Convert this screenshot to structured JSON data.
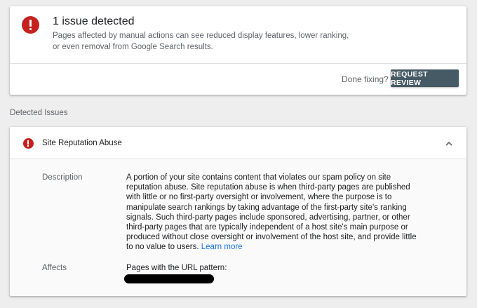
{
  "summary": {
    "title": "1 issue detected",
    "description": "Pages affected by manual actions can see reduced display features, lower ranking, or even removal from Google Search results.",
    "done_fixing_text": "Done fixing?",
    "request_review_label": "REQUEST REVIEW"
  },
  "section_heading": "Detected Issues",
  "issue": {
    "title": "Site Reputation Abuse",
    "description_label": "Description",
    "description_text": "A portion of your site contains content that violates our spam policy on site reputation abuse. Site reputation abuse is when third-party pages are published with little or no first-party oversight or involvement, where the purpose is to manipulate search rankings by taking advantage of the first-party site's ranking signals. Such third-party pages include sponsored, advertising, partner, or other third-party pages that are typically independent of a host site's main purpose or produced without close oversight or involvement of the host site, and provide little to no value to users.",
    "learn_more_label": "Learn more",
    "affects_label": "Affects",
    "affects_value": "Pages with the URL pattern:"
  },
  "colors": {
    "error": "#c5221f",
    "button_bg": "#455a64",
    "link": "#1a73e8"
  },
  "icons": [
    "error-icon",
    "chevron-up-icon"
  ]
}
